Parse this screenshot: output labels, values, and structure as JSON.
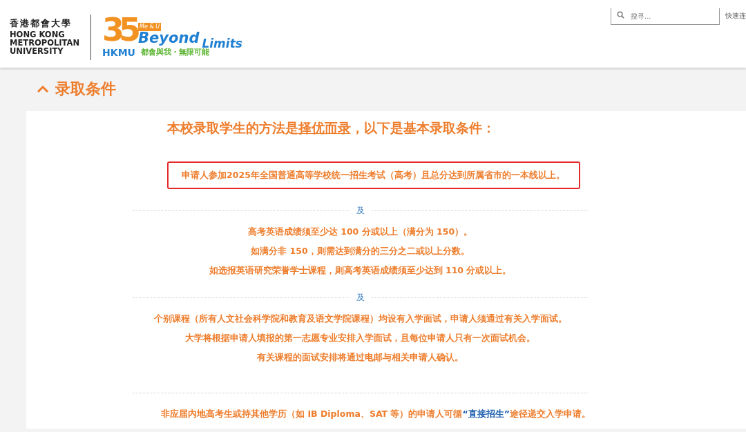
{
  "header": {
    "logo": {
      "name_zh": "香港都會大學",
      "name_en": [
        "HONG KONG",
        "METROPOLITAN",
        "UNIVERSITY"
      ],
      "anniversary": "35",
      "tag": "Me & U",
      "slogan_en": [
        "Beyond",
        "Limits"
      ],
      "short_name": "HKMU",
      "slogan_zh": "都會與我・無限可能"
    },
    "search": {
      "placeholder": "搜寻..."
    },
    "quick_links": "快速连"
  },
  "section": {
    "title": "录取条件",
    "expanded": true
  },
  "card": {
    "headline": {
      "before": "本校录取学生的方法是",
      "link": "择优而录",
      "after": "，以下是基本录取条件："
    },
    "blocks": [
      {
        "kind": "boxed",
        "lines": [
          "申请人参加2025年全国普通高等学校统一招生考试（高考）且总分达到所属省市的一本线以上。"
        ]
      },
      {
        "kind": "separator",
        "label": "及"
      },
      {
        "kind": "lines",
        "lines": [
          "高考英语成绩须至少达 100 分或以上（满分为 150）。",
          "如满分非 150，则需达到满分的三分之二或以上分数。",
          "如选报英语研究荣誉学士课程，则高考英语成绩须至少达到 110 分或以上。"
        ]
      },
      {
        "kind": "separator",
        "label": "及"
      },
      {
        "kind": "lines",
        "lines": [
          "个别课程（所有人文社会科学院和教育及语文学院课程）均设有入学面试，申请人须通过有关入学面试。",
          "大学将根据申请人填报的第一志愿专业安排入学面试，且每位申请人只有一次面试机会。",
          "有关课程的面试安排将通过电邮与相关申请人确认。"
        ]
      },
      {
        "kind": "separator"
      },
      {
        "kind": "note",
        "before": "非应届内地高考生或持其他学历（如 IB Diploma、SAT 等）的申请人可循",
        "link": "“直接招生”",
        "after": "途径递交入学申请。"
      }
    ]
  }
}
